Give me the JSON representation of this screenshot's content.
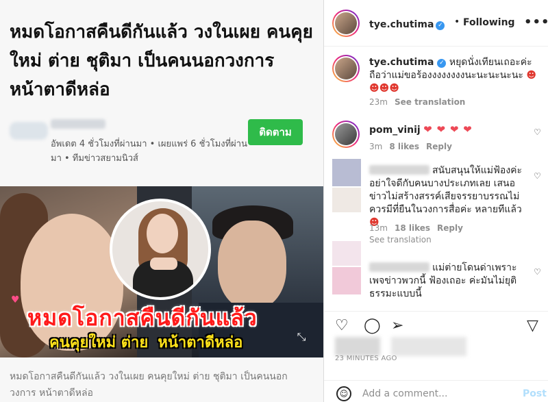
{
  "article": {
    "headline": "หมดโอกาสคืนดีกันแล้ว วงในเผย คนคุยใหม่ ต่าย ชุติมา เป็นคนนอกวงการหน้าตาดีหล่อ",
    "follow_label": "ติดตาม",
    "meta": "อัพเดต 4 ชั่วโมงที่ผ่านมา • เผยแพร่ 6 ชั่วโมงที่ผ่านมา • ทีมข่าวสยามนิวส์",
    "image_title": "หมดโอกาสคืนดีกันแล้ว",
    "image_sub_1": "คนคุยใหม่ ต่าย",
    "image_sub_2": "หน้าตาดีหล่อ",
    "caption": "หมดโอกาสคืนดีกันแล้ว วงในเผย คนคุยใหม่ ต่าย ชุติมา เป็นคนนอกวงการ หน้าตาดีหล่อ"
  },
  "post": {
    "username": "tye.chutima",
    "following_label": "Following",
    "dot": "•",
    "caption_text": "หยุดนั่งเทียนเถอะค่ะ ถือว่าแม่ขอร้องงงงงงงงนะนะนะนะนะ",
    "caption_time": "23m",
    "caption_see_translation": "See translation",
    "like_action": "like",
    "comment_action": "comment",
    "share_action": "share",
    "save_action": "save",
    "time_ago": "23 MINUTES AGO",
    "add_comment_placeholder": "Add a comment...",
    "post_label": "Post"
  },
  "comments": [
    {
      "username": "pom_vinij",
      "text": "❤ ❤ ❤ ❤",
      "time": "3m",
      "likes": "8 likes",
      "reply": "Reply"
    },
    {
      "username": "",
      "text": "สนับสนุนให้แม่ฟ้องค่ะ อย่าใจดีกับคนบางประเภทเลย เสนอข่าวไม่สร้างสรรค์เสียจรรยาบรรณไม่ควรมีที่ยืนในวงการสื่อค่ะ หลายทีแล้ว",
      "time": "13m",
      "likes": "18 likes",
      "reply": "Reply",
      "see_translation": "See translation"
    },
    {
      "username": "",
      "text": "แม่ต่ายโดนด่าเพราะเพจข่าวพวกนี้ ฟ้องเถอะ ค่ะมันไม่ยุติธรรมะแบบนี้"
    }
  ]
}
